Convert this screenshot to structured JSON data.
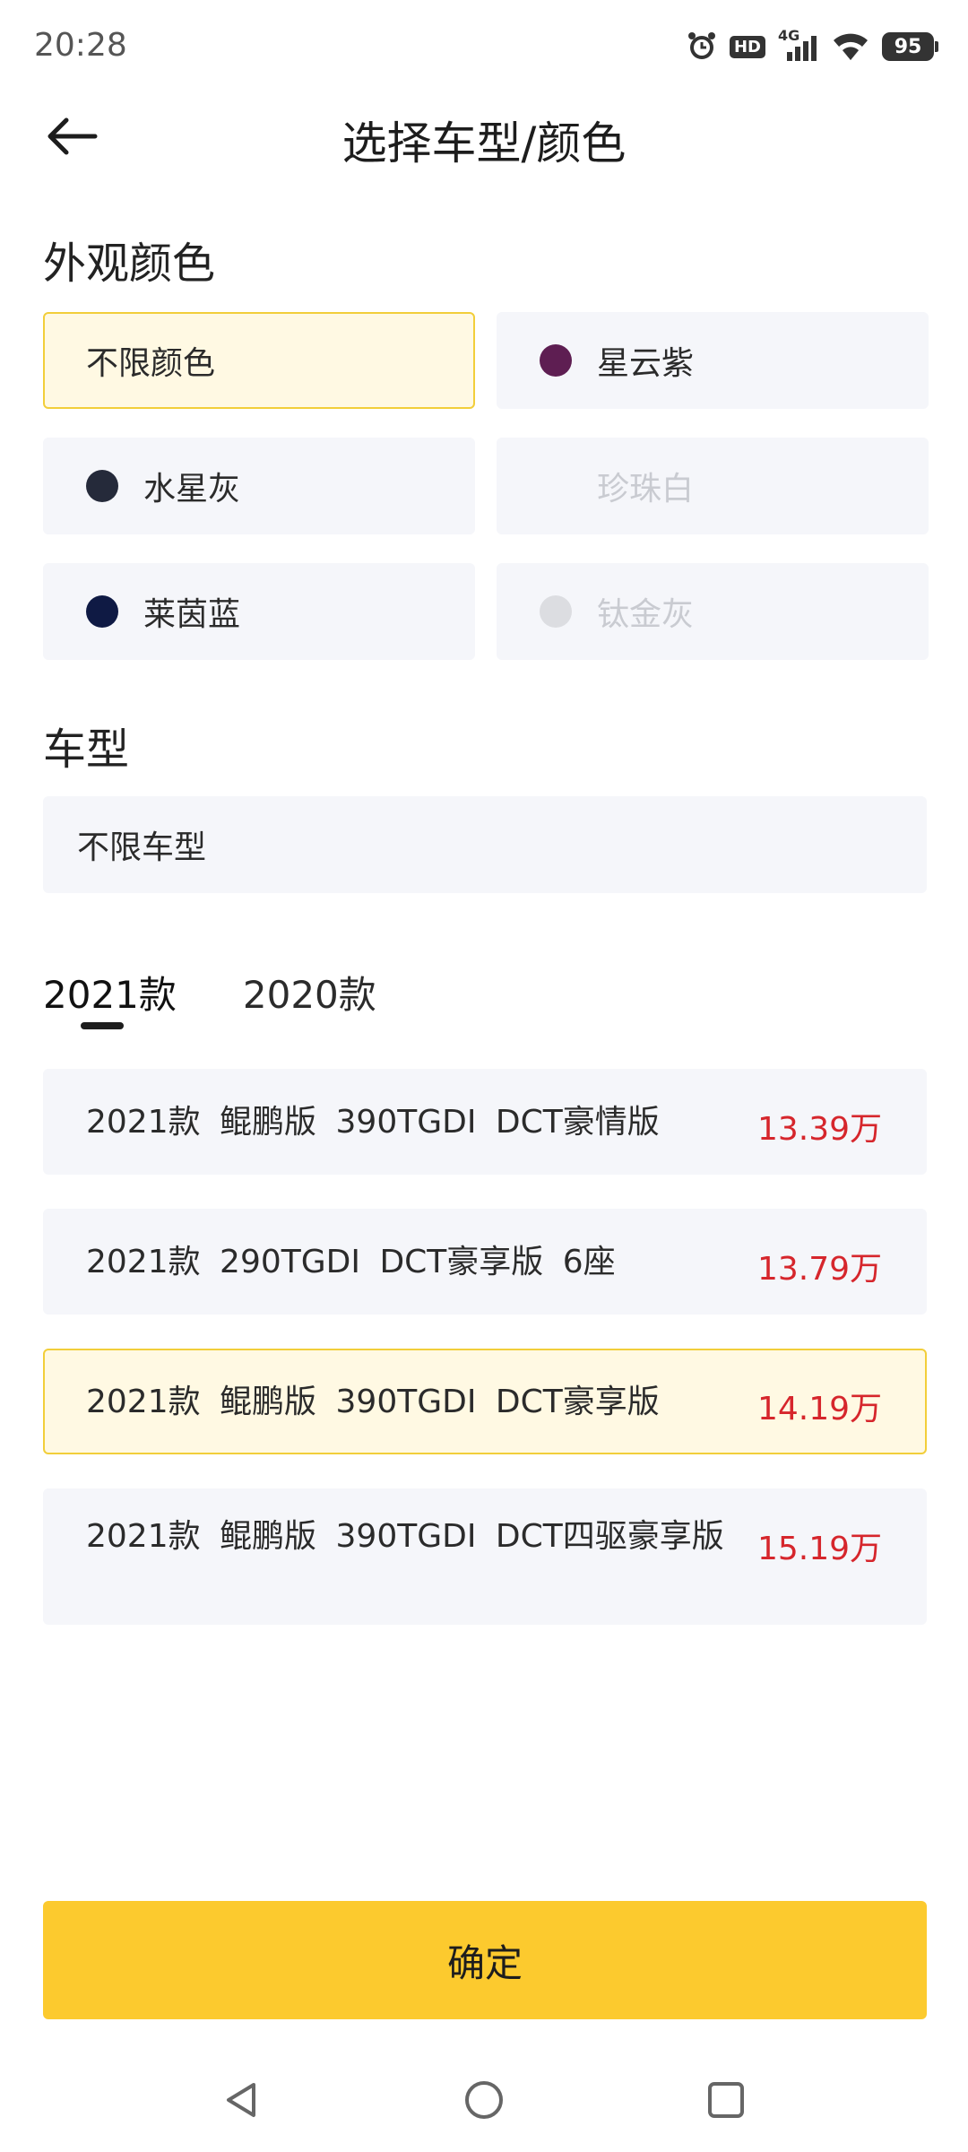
{
  "status_bar": {
    "time": "20:28",
    "hd": "HD",
    "network": "4G",
    "battery": "95"
  },
  "header": {
    "title": "选择车型/颜色"
  },
  "exterior_color": {
    "title": "外观颜色",
    "options": [
      {
        "label": "不限颜色",
        "selected": true,
        "disabled": false,
        "swatch": null
      },
      {
        "label": "星云紫",
        "selected": false,
        "disabled": false,
        "swatch": "#5e1e52"
      },
      {
        "label": "水星灰",
        "selected": false,
        "disabled": false,
        "swatch": "#252a3a"
      },
      {
        "label": "珍珠白",
        "selected": false,
        "disabled": true,
        "swatch": "#f5f6fa"
      },
      {
        "label": "莱茵蓝",
        "selected": false,
        "disabled": false,
        "swatch": "#0f1a44"
      },
      {
        "label": "钛金灰",
        "selected": false,
        "disabled": true,
        "swatch": "#dcdde1"
      }
    ]
  },
  "model": {
    "title": "车型",
    "any_label": "不限车型"
  },
  "year_tabs": [
    {
      "label": "2021款",
      "active": true
    },
    {
      "label": "2020款",
      "active": false
    }
  ],
  "trims": [
    {
      "name": "2021款 鲲鹏版 390TGDI DCT豪情版",
      "price": "13.39万",
      "selected": false
    },
    {
      "name": "2021款 290TGDI DCT豪享版 6座",
      "price": "13.79万",
      "selected": false
    },
    {
      "name": "2021款 鲲鹏版 390TGDI DCT豪享版",
      "price": "14.19万",
      "selected": true
    },
    {
      "name": "2021款 鲲鹏版 390TGDI DCT四驱豪享版",
      "price": "15.19万",
      "selected": false
    }
  ],
  "confirm": {
    "label": "确定"
  },
  "colors": {
    "accent": "#fcca2e",
    "selected_bg": "#fff9e3",
    "selected_border": "#f2ce3a",
    "price": "#d6262c",
    "item_bg": "#f5f6fa"
  },
  "icons": {
    "back": "arrow-left-icon",
    "alarm": "alarm-icon",
    "signal": "signal-bars-icon",
    "wifi": "wifi-icon",
    "nav_back": "triangle-back-icon",
    "nav_home": "circle-home-icon",
    "nav_recents": "square-recents-icon"
  }
}
